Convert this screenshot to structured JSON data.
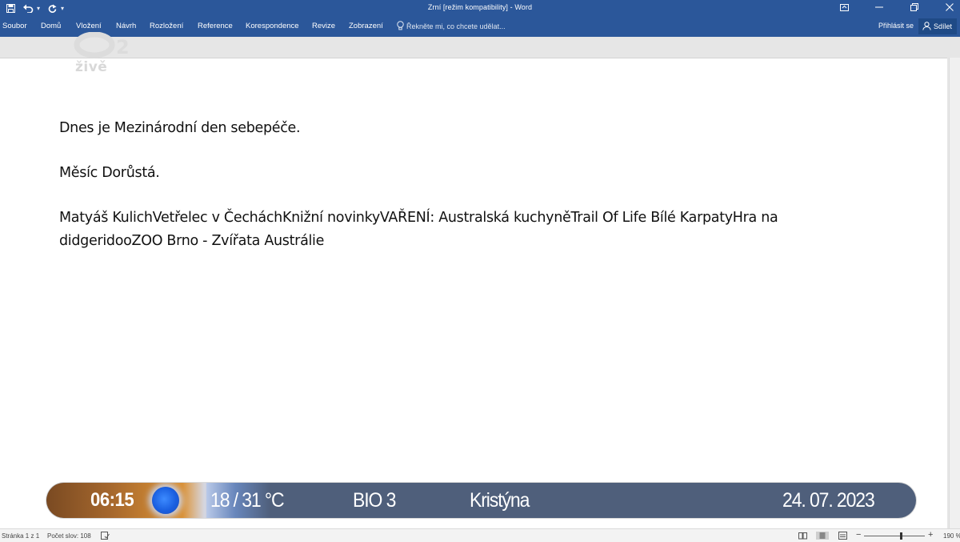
{
  "titlebar": {
    "title": "Zrní [režim kompatibility] - Word"
  },
  "ribbon": {
    "tabs": [
      "Soubor",
      "Domů",
      "Vložení",
      "Návrh",
      "Rozložení",
      "Reference",
      "Korespondence",
      "Revize",
      "Zobrazení"
    ],
    "tell_me": "Řekněte mi, co chcete udělat...",
    "sign_in": "Přihlásit se",
    "share": "Sdílet"
  },
  "watermark": {
    "channel_text": "živě"
  },
  "document": {
    "paragraphs": [
      "Dnes je Mezinárodní den sebepéče.",
      "Měsíc Dorůstá.",
      "Matyáš KulichVetřelec v ČecháchKnižní novinkyVAŘENÍ: Australská kuchyněTrail Of Life Bílé KarpatyHra na didgeridooZOO Brno - Zvířata Austrálie"
    ]
  },
  "ticker": {
    "time": "06:15",
    "temperature": "18 / 31 °C",
    "channel": "BIO 3",
    "name_day": "Kristýna",
    "date": "24. 07. 2023"
  },
  "statusbar": {
    "page": "Stránka 1 z 1",
    "word_count": "Počet slov: 108",
    "zoom": "190 %",
    "zoom_percent": 190
  },
  "colors": {
    "word_blue": "#2b579a",
    "ticker_bar": "#4f5f7b",
    "ticker_warm": "#d28a33"
  }
}
